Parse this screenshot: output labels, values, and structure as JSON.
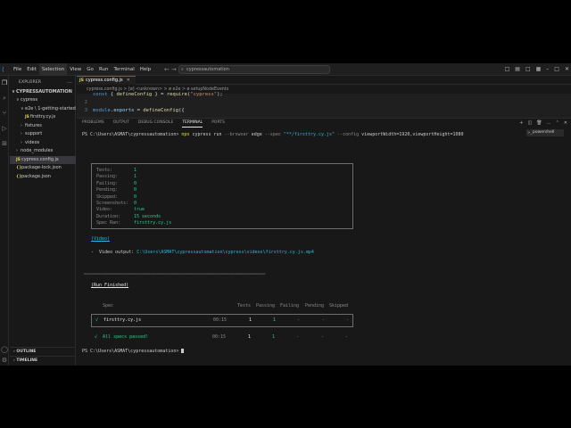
{
  "menu": [
    "File",
    "Edit",
    "Selection",
    "View",
    "Go",
    "Run",
    "Terminal",
    "Help"
  ],
  "command_center": {
    "text": "cypressautomation"
  },
  "explorer": {
    "title": "EXPLORER",
    "root": "CYPRESSAUTOMATION",
    "items": [
      {
        "label": "cypress",
        "icon": "folder",
        "depth": 1,
        "open": true
      },
      {
        "label": "e2e \\ 1-getting-started",
        "icon": "folder",
        "depth": 2,
        "open": true
      },
      {
        "label": "firsttry.cy.js",
        "icon": "js",
        "depth": 3
      },
      {
        "label": "fixtures",
        "icon": "folder",
        "depth": 2
      },
      {
        "label": "support",
        "icon": "folder",
        "depth": 2
      },
      {
        "label": "videos",
        "icon": "folder",
        "depth": 2
      },
      {
        "label": "node_modules",
        "icon": "folder",
        "depth": 1
      },
      {
        "label": "cypress.config.js",
        "icon": "js",
        "depth": 1,
        "selected": true
      },
      {
        "label": "package-lock.json",
        "icon": "json",
        "depth": 1
      },
      {
        "label": "package.json",
        "icon": "json",
        "depth": 1
      }
    ],
    "outline": "OUTLINE",
    "timeline": "TIMELINE"
  },
  "editor": {
    "tab": "cypress.config.js",
    "breadcrumb": "cypress.config.js > [ø] <unknown> > ø e2e > ø setupNodeEvents",
    "lines": [
      {
        "n": "",
        "text": "const { defineConfig } = require(\"cypress\");"
      },
      {
        "n": "2",
        "text": ""
      },
      {
        "n": "3",
        "text": "module.exports = defineConfig({"
      }
    ]
  },
  "panel": {
    "tabs": [
      "PROBLEMS",
      "OUTPUT",
      "DEBUG CONSOLE",
      "TERMINAL",
      "PORTS"
    ],
    "active_tab": "TERMINAL",
    "shell": "powershell"
  },
  "terminal": {
    "prompt": "PS C:\\Users\\ASMAT\\cypressautomation>",
    "cmd_npx": "npx",
    "cmd_cypress": "cypress",
    "cmd_run": "run",
    "flag_browser": "--browser",
    "browser": "edge",
    "flag_spec": "--spec",
    "spec_arg": "\"**/firsttry.cy.js\"",
    "flag_config": "--config",
    "config_arg": "viewportWidth=1920,viewportHeight=1080",
    "summary": [
      {
        "k": "Tests:",
        "v": "1"
      },
      {
        "k": "Passing:",
        "v": "1"
      },
      {
        "k": "Failing:",
        "v": "0"
      },
      {
        "k": "Pending:",
        "v": "0"
      },
      {
        "k": "Skipped:",
        "v": "0"
      },
      {
        "k": "Screenshots:",
        "v": "0"
      },
      {
        "k": "Video:",
        "v": "true"
      },
      {
        "k": "Duration:",
        "v": "15 seconds"
      },
      {
        "k": "Spec Ran:",
        "v": "firsttry.cy.js"
      }
    ],
    "video_header": "(Video)",
    "video_label": "-  Video output:",
    "video_path": "C:\\Users\\ASMAT\\cypressautomation\\cypress\\videos\\firsttry.cy.js.mp4",
    "divider": "==========================================================================================",
    "run_finished": "(Run Finished)",
    "table_headers": {
      "spec": "Spec",
      "tests": "Tests",
      "passing": "Passing",
      "failing": "Failing",
      "pending": "Pending",
      "skipped": "Skipped"
    },
    "row": {
      "check": "√",
      "spec": "firsttry.cy.js",
      "time": "00:15",
      "tests": "1",
      "passing": "1",
      "failing": "-",
      "pending": "-",
      "skipped": "-"
    },
    "total": {
      "label": "√  All specs passed!",
      "time": "00:15",
      "tests": "1",
      "passing": "1",
      "failing": "-",
      "pending": "-",
      "skipped": "-"
    },
    "final_prompt": "PS C:\\Users\\ASMAT\\cypressautomation>"
  }
}
